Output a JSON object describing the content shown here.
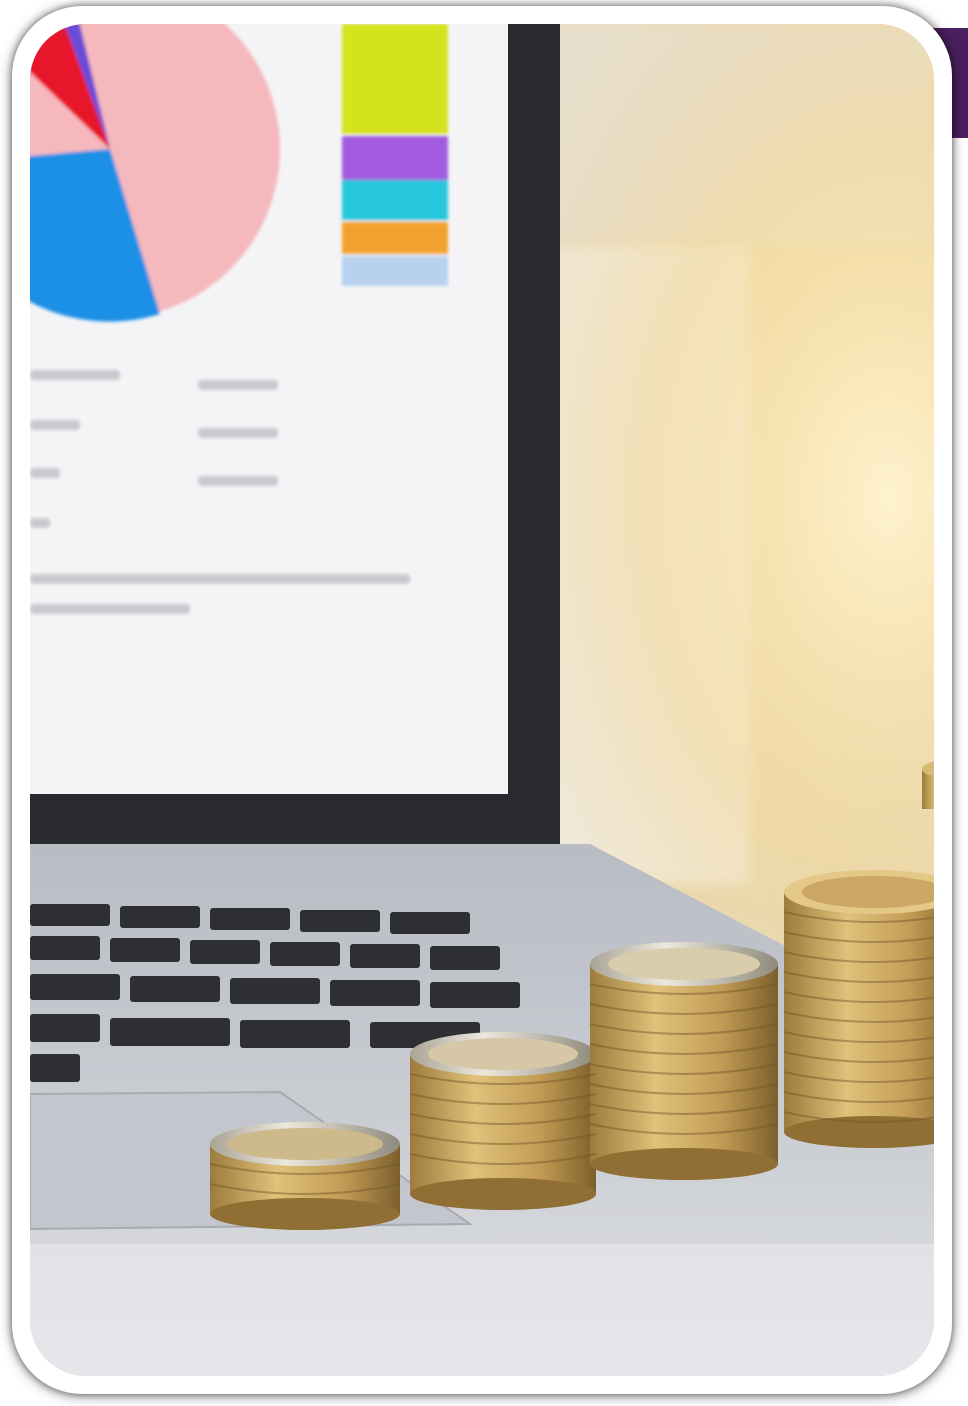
{
  "image": {
    "subject": "laptop-with-coin-stacks",
    "palette": {
      "frame": "#ffffff",
      "corner_accent": "#4a1f5e",
      "window_glow": "#f3d79a",
      "screen": "#f4f4f6",
      "laptop_body": "#c9cbd0",
      "keys": "#2d2f33",
      "coin_gold": "#c8a862",
      "coin_silver": "#d7d3c7"
    },
    "screen_chart": {
      "type": "pie",
      "slice_colors": [
        "#f5b8bd",
        "#1e90e6",
        "#e8192c"
      ],
      "legend_colors": [
        "#d5e31f",
        "#a25ae0",
        "#27c6dc",
        "#f3a12d",
        "#b7d1ee"
      ]
    },
    "coin_stacks": [
      {
        "name": "small-stack",
        "coins": 4
      },
      {
        "name": "medium-stack",
        "coins": 9
      },
      {
        "name": "tall-stack",
        "coins": 15
      },
      {
        "name": "tallest-stack",
        "coins": 20
      }
    ]
  }
}
